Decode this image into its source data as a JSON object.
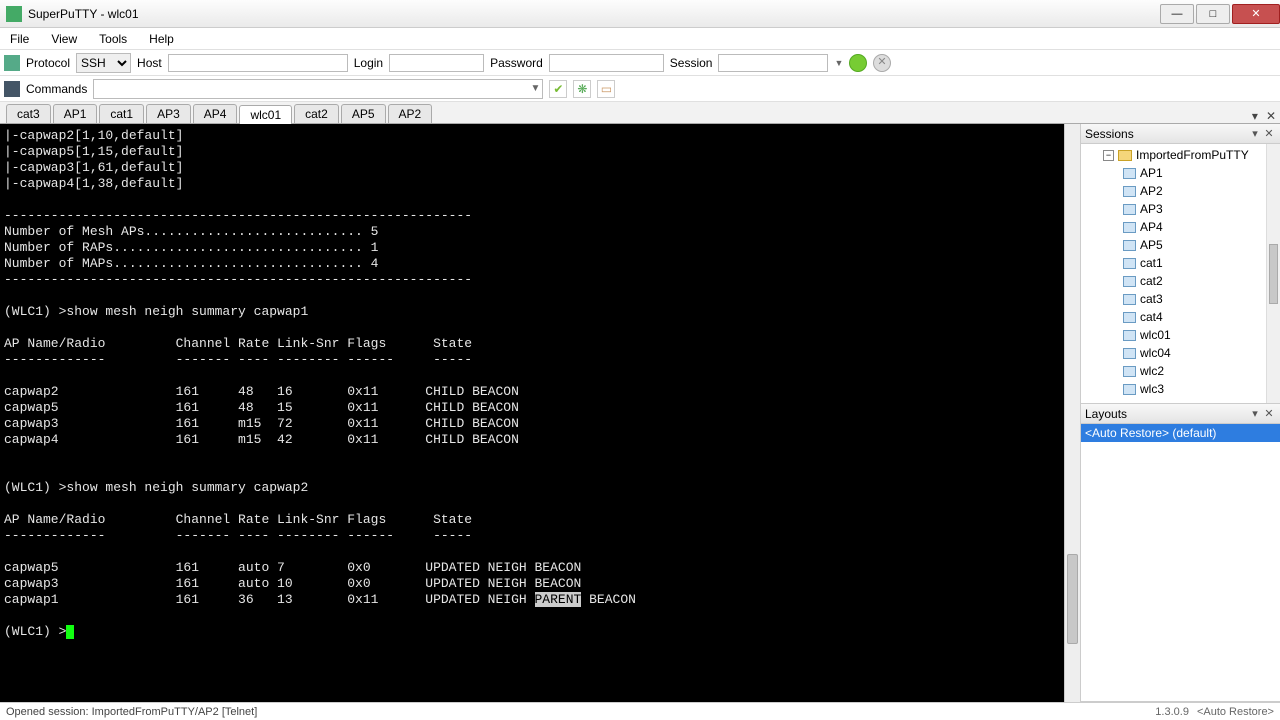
{
  "window": {
    "title": "SuperPuTTY - wlc01"
  },
  "menu": {
    "file": "File",
    "view": "View",
    "tools": "Tools",
    "help": "Help"
  },
  "toolbar": {
    "protocol_label": "Protocol",
    "protocol_value": "SSH",
    "host_label": "Host",
    "host_value": "",
    "login_label": "Login",
    "login_value": "",
    "password_label": "Password",
    "password_value": "",
    "session_label": "Session",
    "session_value": ""
  },
  "commands": {
    "label": "Commands",
    "value": ""
  },
  "tabs": [
    "cat3",
    "AP1",
    "cat1",
    "AP3",
    "AP4",
    "wlc01",
    "cat2",
    "AP5",
    "AP2"
  ],
  "active_tab": "wlc01",
  "terminal": {
    "lines": [
      "|-capwap2[1,10,default]",
      "|-capwap5[1,15,default]",
      "|-capwap3[1,61,default]",
      "|-capwap4[1,38,default]",
      "",
      "------------------------------------------------------------",
      "Number of Mesh APs............................ 5",
      "Number of RAPs................................ 1",
      "Number of MAPs................................ 4",
      "------------------------------------------------------------",
      "",
      "(WLC1) >show mesh neigh summary capwap1",
      "",
      "AP Name/Radio         Channel Rate Link-Snr Flags      State",
      "-------------         ------- ---- -------- ------     -----",
      "",
      "capwap2               161     48   16       0x11      CHILD BEACON",
      "capwap5               161     48   15       0x11      CHILD BEACON",
      "capwap3               161     m15  72       0x11      CHILD BEACON",
      "capwap4               161     m15  42       0x11      CHILD BEACON",
      "",
      "",
      "(WLC1) >show mesh neigh summary capwap2",
      "",
      "AP Name/Radio         Channel Rate Link-Snr Flags      State",
      "-------------         ------- ---- -------- ------     -----",
      "",
      "capwap5               161     auto 7        0x0       UPDATED NEIGH BEACON",
      "capwap3               161     auto 10       0x0       UPDATED NEIGH BEACON"
    ],
    "highlighted_line_prefix": "capwap1               161     36   13       0x11      UPDATED NEIGH ",
    "highlighted_word": "PARENT",
    "highlighted_line_suffix": " BEACON",
    "prompt": "(WLC1) >"
  },
  "sessions": {
    "title": "Sessions",
    "root": "ImportedFromPuTTY",
    "items": [
      "AP1",
      "AP2",
      "AP3",
      "AP4",
      "AP5",
      "cat1",
      "cat2",
      "cat3",
      "cat4",
      "wlc01",
      "wlc04",
      "wlc2",
      "wlc3"
    ]
  },
  "layouts": {
    "title": "Layouts",
    "selected": "<Auto Restore> (default)"
  },
  "status": {
    "left": "Opened session: ImportedFromPuTTY/AP2 [Telnet]",
    "version": "1.3.0.9",
    "right": "<Auto Restore>"
  }
}
